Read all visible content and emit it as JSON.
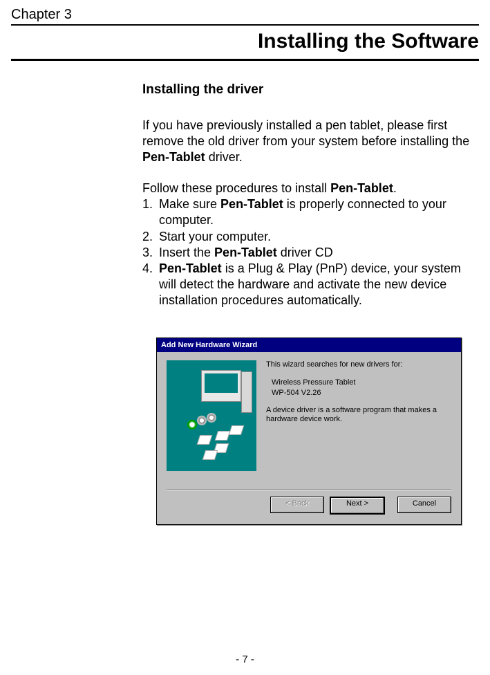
{
  "chapter": {
    "label": "Chapter 3",
    "title": "Installing the Software"
  },
  "section": {
    "heading": "Installing the driver",
    "intro_pre": "If you have previously installed a pen tablet, please first remove the old driver from your system before install­ing the ",
    "intro_bold": "Pen-Tablet",
    "intro_post": " driver.",
    "procedure_intro_pre": "Follow these procedures to install ",
    "procedure_intro_bold": "Pen-Tablet",
    "procedure_intro_post": ".",
    "steps": {
      "s1": {
        "num": "1.",
        "pre": "Make sure ",
        "bold": "Pen-Tablet",
        "post": " is properly connected to your computer."
      },
      "s2": {
        "num": "2.",
        "text": "Start your computer."
      },
      "s3": {
        "num": "3.",
        "pre": "Insert the ",
        "bold": "Pen-Tablet",
        "post": " driver CD"
      },
      "s4": {
        "num": "4.",
        "bold": "Pen-Tablet",
        "post": " is a Plug & Play (PnP) device, your system will detect the hardware and activate the new device installation procedures automatically."
      }
    }
  },
  "wizard": {
    "title": "Add New Hardware Wizard",
    "line1": "This wizard searches for new drivers for:",
    "device_line1": "Wireless Pressure Tablet",
    "device_line2": "WP-504 V2.26",
    "desc": "A device driver is a software program that makes a hardware device work.",
    "buttons": {
      "back": "< Back",
      "next": "Next >",
      "cancel": "Cancel"
    }
  },
  "page_number": "- 7 -"
}
